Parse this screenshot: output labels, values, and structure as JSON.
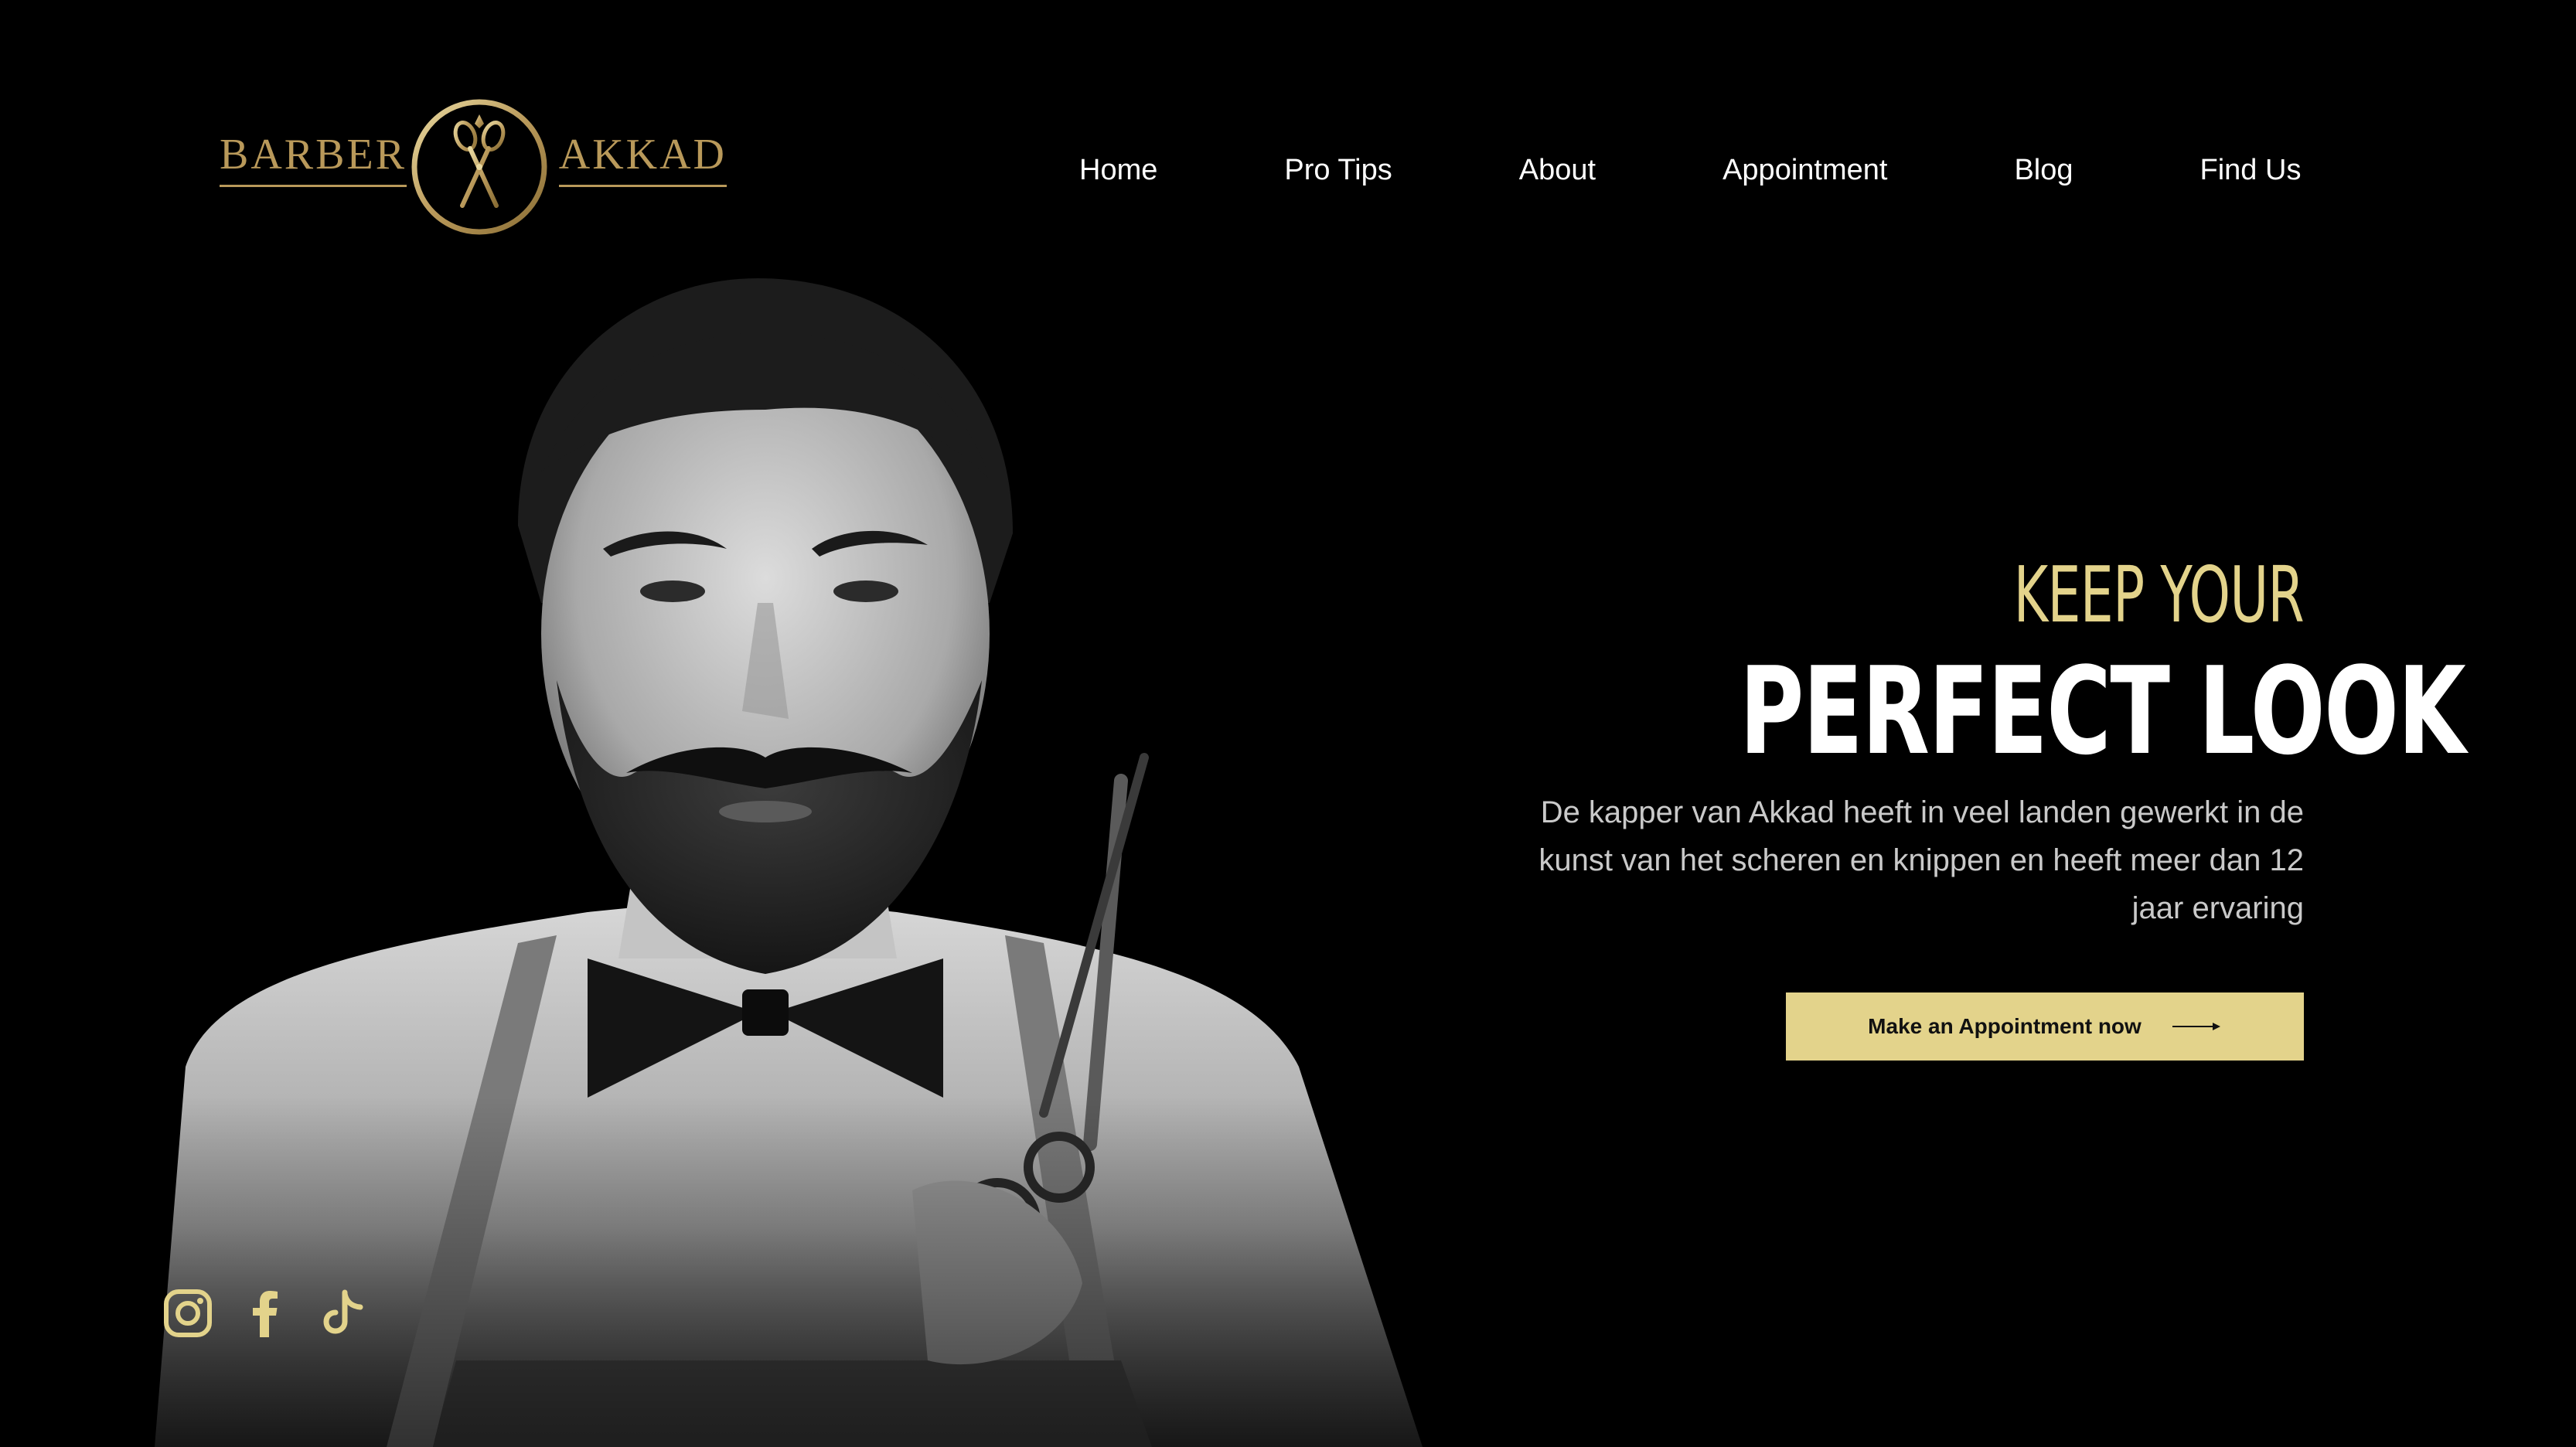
{
  "brand": {
    "left_word": "BARBER",
    "right_word": "AKKAD",
    "emblem_icon": "scissors-circle-icon",
    "color": "#b9995a"
  },
  "nav": {
    "items": [
      {
        "label": "Home"
      },
      {
        "label": "Pro Tips"
      },
      {
        "label": "About"
      },
      {
        "label": "Appointment"
      },
      {
        "label": "Blog"
      },
      {
        "label": "Find Us"
      }
    ]
  },
  "hero": {
    "kicker": "KEEP YOUR",
    "title": "PERFECT LOOK",
    "text": "De kapper van Akkad heeft in veel landen gewerkt in de kunst van het scheren en knippen en heeft meer dan 12 jaar ervaring",
    "cta_label": "Make an Appointment now",
    "cta_icon": "arrow-right-icon",
    "accent_color": "#e3d38b"
  },
  "social": {
    "icons": [
      "instagram-icon",
      "facebook-icon",
      "tiktok-icon"
    ],
    "color": "#e3d38b"
  }
}
